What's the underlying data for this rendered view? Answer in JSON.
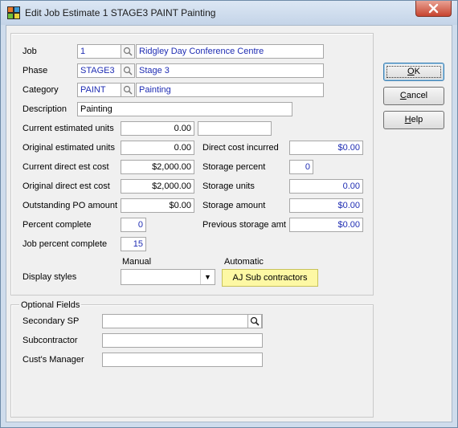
{
  "window": {
    "title": "Edit Job Estimate 1 STAGE3 PAINT Painting"
  },
  "labels": {
    "job": "Job",
    "phase": "Phase",
    "category": "Category",
    "description": "Description",
    "current_estimated_units": "Current estimated units",
    "original_estimated_units": "Original estimated units",
    "current_direct_est_cost": "Current direct est cost",
    "original_direct_est_cost": "Original direct est cost",
    "outstanding_po_amount": "Outstanding PO amount",
    "percent_complete": "Percent complete",
    "job_percent_complete": "Job percent complete",
    "direct_cost_incurred": "Direct cost incurred",
    "storage_percent": "Storage percent",
    "storage_units": "Storage units",
    "storage_amount": "Storage amount",
    "previous_storage_amt": "Previous storage amt",
    "manual": "Manual",
    "automatic": "Automatic",
    "display_styles": "Display styles"
  },
  "values": {
    "job_code": "1",
    "job_name": "Ridgley Day Conference Centre",
    "phase_code": "STAGE3",
    "phase_name": "Stage 3",
    "category_code": "PAINT",
    "category_name": "Painting",
    "description": "Painting",
    "current_estimated_units": "0.00",
    "current_estimated_units_extra": "",
    "original_estimated_units": "0.00",
    "current_direct_est_cost": "$2,000.00",
    "original_direct_est_cost": "$2,000.00",
    "outstanding_po_amount": "$0.00",
    "percent_complete": "0",
    "job_percent_complete": "15",
    "direct_cost_incurred": "$0.00",
    "storage_percent": "0",
    "storage_units": "0.00",
    "storage_amount": "$0.00",
    "previous_storage_amt": "$0.00",
    "display_style_manual": "",
    "display_style_automatic": "AJ Sub contractors"
  },
  "buttons": {
    "ok_prefix": "",
    "ok_key": "O",
    "ok_rest": "K",
    "cancel_prefix": "",
    "cancel_key": "C",
    "cancel_rest": "ancel",
    "help_prefix": "",
    "help_key": "H",
    "help_rest": "elp"
  },
  "optional": {
    "group_title": "Optional Fields",
    "secondary_sp_label": "Secondary SP",
    "secondary_sp_value": "",
    "subcontractor_label": "Subcontractor",
    "subcontractor_value": "",
    "custs_manager_label": "Cust's Manager",
    "custs_manager_value": ""
  },
  "icons": {
    "app": "app-icon",
    "close": "close-icon",
    "lookup": "magnifier-icon",
    "dropdown": "chevron-down-icon"
  },
  "colors": {
    "link_text": "#1f2db3",
    "automatic_style_bg": "#fdf8a4",
    "titlebar": "#cfdcec",
    "close": "#c7442f"
  }
}
